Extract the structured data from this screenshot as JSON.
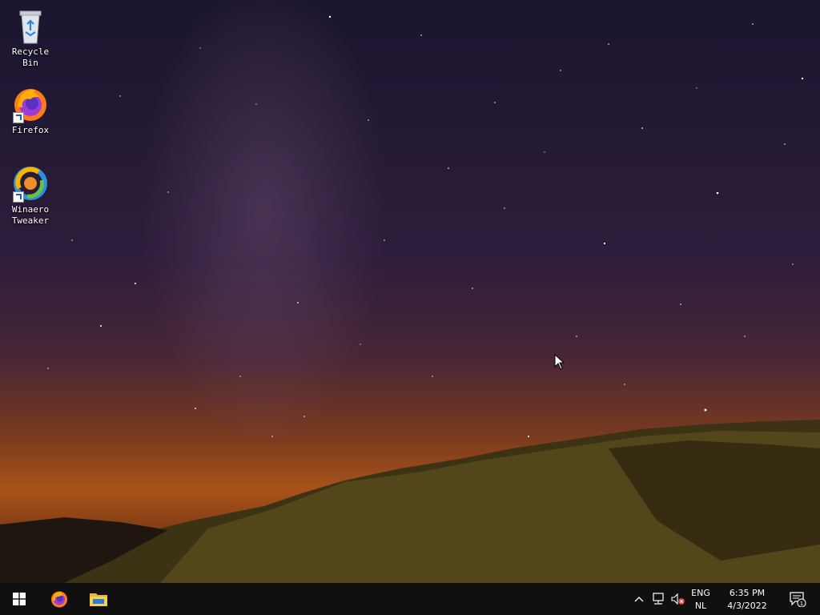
{
  "desktop": {
    "icons": [
      {
        "label": "Recycle Bin",
        "icon": "recycle-bin-icon"
      },
      {
        "label": "Firefox",
        "icon": "firefox-icon"
      },
      {
        "label": "Winaero Tweaker",
        "icon": "winaero-tweaker-icon"
      }
    ]
  },
  "taskbar": {
    "start_icon": "windows-start-icon",
    "pinned": [
      {
        "name": "Firefox",
        "icon": "firefox-icon"
      },
      {
        "name": "File Explorer",
        "icon": "file-explorer-icon"
      }
    ],
    "tray": {
      "show_hidden_icon": "chevron-up-icon",
      "network_icon": "network-icon",
      "volume_icon": "volume-muted-icon",
      "language_top": "ENG",
      "language_bottom": "NL",
      "time": "6:35 PM",
      "date": "4/3/2022",
      "notification_count": "1"
    }
  },
  "colors": {
    "taskbar_bg": "#101010",
    "sky_top": "#1b1530",
    "horizon_glow": "#a9521a"
  }
}
